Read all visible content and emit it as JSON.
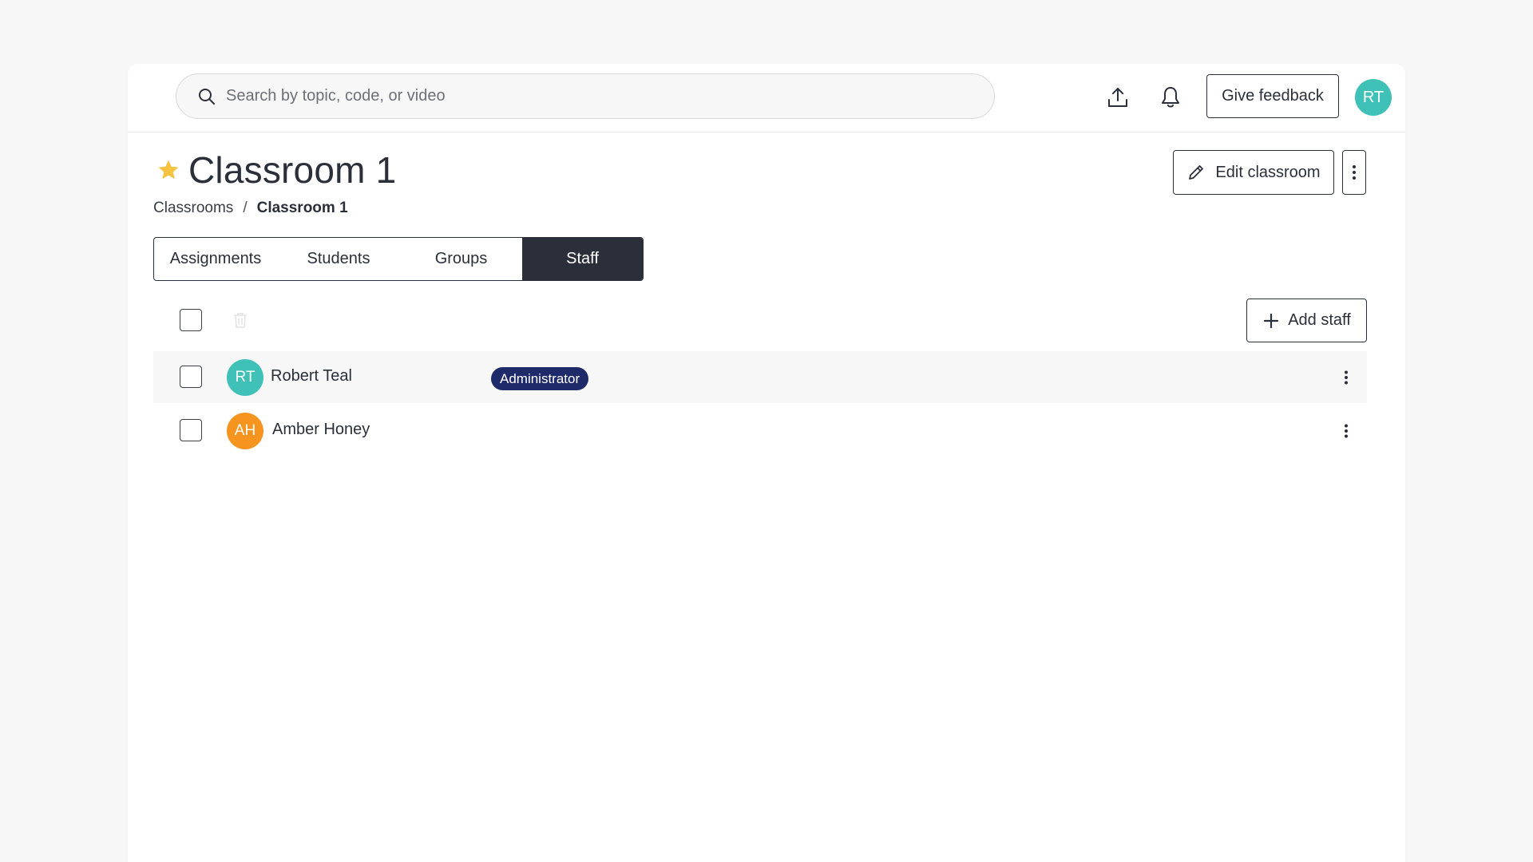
{
  "header": {
    "search_placeholder": "Search by topic, code, or video",
    "feedback_label": "Give feedback",
    "user_initials": "RT",
    "user_avatar_color": "#3fc1b8"
  },
  "page": {
    "title": "Classroom 1",
    "edit_label": "Edit classroom",
    "breadcrumb": {
      "root": "Classrooms",
      "separator": "/",
      "current": "Classroom 1"
    }
  },
  "tabs": [
    {
      "label": "Assignments",
      "active": false
    },
    {
      "label": "Students",
      "active": false
    },
    {
      "label": "Groups",
      "active": false
    },
    {
      "label": "Staff",
      "active": true
    }
  ],
  "toolbar": {
    "add_label": "Add staff"
  },
  "staff": [
    {
      "initials": "RT",
      "name": "Robert Teal",
      "role": "Administrator",
      "avatar_color": "#3fc1b8"
    },
    {
      "initials": "AH",
      "name": "Amber Honey",
      "role": "",
      "avatar_color": "#f5951f"
    }
  ],
  "colors": {
    "primary_dark": "#2b2f3a",
    "badge": "#1f2a6b",
    "star": "#f5c242"
  }
}
